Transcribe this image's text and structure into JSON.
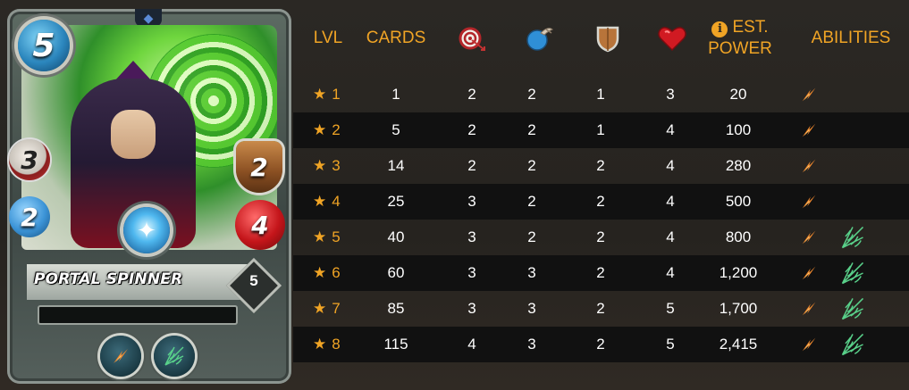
{
  "card": {
    "name": "PORTAL SPINNER",
    "mana": "5",
    "ranged": "3",
    "speed": "2",
    "armor": "2",
    "health": "4",
    "level": "5",
    "abilities": [
      "blast-icon",
      "web-icon"
    ]
  },
  "table": {
    "headers": {
      "lvl": "LVL",
      "cards": "CARDS",
      "ranged_icon": "ranged-attack-icon",
      "speed_icon": "speed-icon",
      "armor_icon": "armor-shield-icon",
      "health_icon": "health-heart-icon",
      "power": "EST. POWER",
      "power_line1": "EST.",
      "power_line2": "POWER",
      "abilities": "ABILITIES"
    },
    "rows": [
      {
        "lvl": "1",
        "cards": "1",
        "ranged": "2",
        "speed": "2",
        "armor": "1",
        "health": "3",
        "power": "20",
        "abilities": [
          "blast-icon"
        ]
      },
      {
        "lvl": "2",
        "cards": "5",
        "ranged": "2",
        "speed": "2",
        "armor": "1",
        "health": "4",
        "power": "100",
        "abilities": [
          "blast-icon"
        ]
      },
      {
        "lvl": "3",
        "cards": "14",
        "ranged": "2",
        "speed": "2",
        "armor": "2",
        "health": "4",
        "power": "280",
        "abilities": [
          "blast-icon"
        ]
      },
      {
        "lvl": "4",
        "cards": "25",
        "ranged": "3",
        "speed": "2",
        "armor": "2",
        "health": "4",
        "power": "500",
        "abilities": [
          "blast-icon"
        ]
      },
      {
        "lvl": "5",
        "cards": "40",
        "ranged": "3",
        "speed": "2",
        "armor": "2",
        "health": "4",
        "power": "800",
        "abilities": [
          "blast-icon",
          "web-icon"
        ]
      },
      {
        "lvl": "6",
        "cards": "60",
        "ranged": "3",
        "speed": "3",
        "armor": "2",
        "health": "4",
        "power": "1,200",
        "abilities": [
          "blast-icon",
          "web-icon"
        ]
      },
      {
        "lvl": "7",
        "cards": "85",
        "ranged": "3",
        "speed": "3",
        "armor": "2",
        "health": "5",
        "power": "1,700",
        "abilities": [
          "blast-icon",
          "web-icon"
        ]
      },
      {
        "lvl": "8",
        "cards": "115",
        "ranged": "4",
        "speed": "3",
        "armor": "2",
        "health": "5",
        "power": "2,415",
        "abilities": [
          "blast-icon",
          "web-icon"
        ]
      }
    ]
  },
  "colors": {
    "accent": "#f0a425",
    "row_dark": "#111111",
    "background": "#2a2622"
  }
}
